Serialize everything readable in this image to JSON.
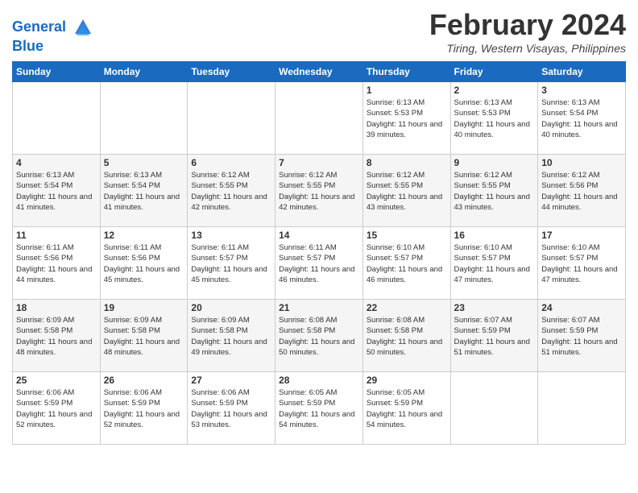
{
  "header": {
    "logo_line1": "General",
    "logo_line2": "Blue",
    "month": "February 2024",
    "location": "Tiring, Western Visayas, Philippines"
  },
  "weekdays": [
    "Sunday",
    "Monday",
    "Tuesday",
    "Wednesday",
    "Thursday",
    "Friday",
    "Saturday"
  ],
  "weeks": [
    [
      {
        "day": "",
        "sunrise": "",
        "sunset": "",
        "daylight": ""
      },
      {
        "day": "",
        "sunrise": "",
        "sunset": "",
        "daylight": ""
      },
      {
        "day": "",
        "sunrise": "",
        "sunset": "",
        "daylight": ""
      },
      {
        "day": "",
        "sunrise": "",
        "sunset": "",
        "daylight": ""
      },
      {
        "day": "1",
        "sunrise": "Sunrise: 6:13 AM",
        "sunset": "Sunset: 5:53 PM",
        "daylight": "Daylight: 11 hours and 39 minutes."
      },
      {
        "day": "2",
        "sunrise": "Sunrise: 6:13 AM",
        "sunset": "Sunset: 5:53 PM",
        "daylight": "Daylight: 11 hours and 40 minutes."
      },
      {
        "day": "3",
        "sunrise": "Sunrise: 6:13 AM",
        "sunset": "Sunset: 5:54 PM",
        "daylight": "Daylight: 11 hours and 40 minutes."
      }
    ],
    [
      {
        "day": "4",
        "sunrise": "Sunrise: 6:13 AM",
        "sunset": "Sunset: 5:54 PM",
        "daylight": "Daylight: 11 hours and 41 minutes."
      },
      {
        "day": "5",
        "sunrise": "Sunrise: 6:13 AM",
        "sunset": "Sunset: 5:54 PM",
        "daylight": "Daylight: 11 hours and 41 minutes."
      },
      {
        "day": "6",
        "sunrise": "Sunrise: 6:12 AM",
        "sunset": "Sunset: 5:55 PM",
        "daylight": "Daylight: 11 hours and 42 minutes."
      },
      {
        "day": "7",
        "sunrise": "Sunrise: 6:12 AM",
        "sunset": "Sunset: 5:55 PM",
        "daylight": "Daylight: 11 hours and 42 minutes."
      },
      {
        "day": "8",
        "sunrise": "Sunrise: 6:12 AM",
        "sunset": "Sunset: 5:55 PM",
        "daylight": "Daylight: 11 hours and 43 minutes."
      },
      {
        "day": "9",
        "sunrise": "Sunrise: 6:12 AM",
        "sunset": "Sunset: 5:55 PM",
        "daylight": "Daylight: 11 hours and 43 minutes."
      },
      {
        "day": "10",
        "sunrise": "Sunrise: 6:12 AM",
        "sunset": "Sunset: 5:56 PM",
        "daylight": "Daylight: 11 hours and 44 minutes."
      }
    ],
    [
      {
        "day": "11",
        "sunrise": "Sunrise: 6:11 AM",
        "sunset": "Sunset: 5:56 PM",
        "daylight": "Daylight: 11 hours and 44 minutes."
      },
      {
        "day": "12",
        "sunrise": "Sunrise: 6:11 AM",
        "sunset": "Sunset: 5:56 PM",
        "daylight": "Daylight: 11 hours and 45 minutes."
      },
      {
        "day": "13",
        "sunrise": "Sunrise: 6:11 AM",
        "sunset": "Sunset: 5:57 PM",
        "daylight": "Daylight: 11 hours and 45 minutes."
      },
      {
        "day": "14",
        "sunrise": "Sunrise: 6:11 AM",
        "sunset": "Sunset: 5:57 PM",
        "daylight": "Daylight: 11 hours and 46 minutes."
      },
      {
        "day": "15",
        "sunrise": "Sunrise: 6:10 AM",
        "sunset": "Sunset: 5:57 PM",
        "daylight": "Daylight: 11 hours and 46 minutes."
      },
      {
        "day": "16",
        "sunrise": "Sunrise: 6:10 AM",
        "sunset": "Sunset: 5:57 PM",
        "daylight": "Daylight: 11 hours and 47 minutes."
      },
      {
        "day": "17",
        "sunrise": "Sunrise: 6:10 AM",
        "sunset": "Sunset: 5:57 PM",
        "daylight": "Daylight: 11 hours and 47 minutes."
      }
    ],
    [
      {
        "day": "18",
        "sunrise": "Sunrise: 6:09 AM",
        "sunset": "Sunset: 5:58 PM",
        "daylight": "Daylight: 11 hours and 48 minutes."
      },
      {
        "day": "19",
        "sunrise": "Sunrise: 6:09 AM",
        "sunset": "Sunset: 5:58 PM",
        "daylight": "Daylight: 11 hours and 48 minutes."
      },
      {
        "day": "20",
        "sunrise": "Sunrise: 6:09 AM",
        "sunset": "Sunset: 5:58 PM",
        "daylight": "Daylight: 11 hours and 49 minutes."
      },
      {
        "day": "21",
        "sunrise": "Sunrise: 6:08 AM",
        "sunset": "Sunset: 5:58 PM",
        "daylight": "Daylight: 11 hours and 50 minutes."
      },
      {
        "day": "22",
        "sunrise": "Sunrise: 6:08 AM",
        "sunset": "Sunset: 5:58 PM",
        "daylight": "Daylight: 11 hours and 50 minutes."
      },
      {
        "day": "23",
        "sunrise": "Sunrise: 6:07 AM",
        "sunset": "Sunset: 5:59 PM",
        "daylight": "Daylight: 11 hours and 51 minutes."
      },
      {
        "day": "24",
        "sunrise": "Sunrise: 6:07 AM",
        "sunset": "Sunset: 5:59 PM",
        "daylight": "Daylight: 11 hours and 51 minutes."
      }
    ],
    [
      {
        "day": "25",
        "sunrise": "Sunrise: 6:06 AM",
        "sunset": "Sunset: 5:59 PM",
        "daylight": "Daylight: 11 hours and 52 minutes."
      },
      {
        "day": "26",
        "sunrise": "Sunrise: 6:06 AM",
        "sunset": "Sunset: 5:59 PM",
        "daylight": "Daylight: 11 hours and 52 minutes."
      },
      {
        "day": "27",
        "sunrise": "Sunrise: 6:06 AM",
        "sunset": "Sunset: 5:59 PM",
        "daylight": "Daylight: 11 hours and 53 minutes."
      },
      {
        "day": "28",
        "sunrise": "Sunrise: 6:05 AM",
        "sunset": "Sunset: 5:59 PM",
        "daylight": "Daylight: 11 hours and 54 minutes."
      },
      {
        "day": "29",
        "sunrise": "Sunrise: 6:05 AM",
        "sunset": "Sunset: 5:59 PM",
        "daylight": "Daylight: 11 hours and 54 minutes."
      },
      {
        "day": "",
        "sunrise": "",
        "sunset": "",
        "daylight": ""
      },
      {
        "day": "",
        "sunrise": "",
        "sunset": "",
        "daylight": ""
      }
    ]
  ]
}
